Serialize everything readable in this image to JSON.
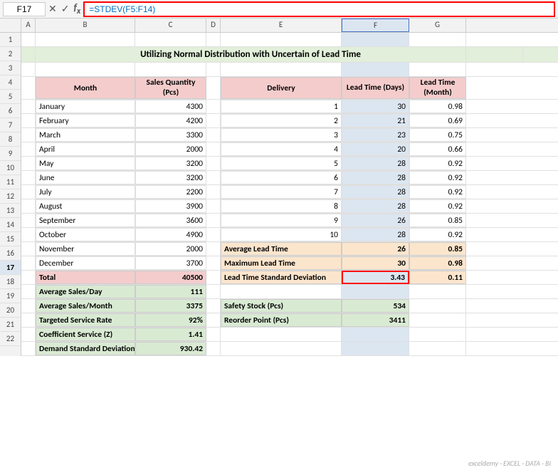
{
  "formula_bar": {
    "cell_ref": "F17",
    "formula": "=STDEV(F5:F14)",
    "icons": [
      "cancel",
      "confirm",
      "function"
    ]
  },
  "col_headers": [
    "",
    "A",
    "B",
    "C",
    "D",
    "E",
    "F",
    "G"
  ],
  "title": "Utilizing Normal Distribution with Uncertain of Lead Time",
  "months": [
    {
      "month": "January",
      "qty": "4300"
    },
    {
      "month": "February",
      "qty": "4200"
    },
    {
      "month": "March",
      "qty": "3300"
    },
    {
      "month": "April",
      "qty": "2000"
    },
    {
      "month": "May",
      "qty": "3200"
    },
    {
      "month": "June",
      "qty": "3200"
    },
    {
      "month": "July",
      "qty": "2200"
    },
    {
      "month": "August",
      "qty": "3900"
    },
    {
      "month": "September",
      "qty": "3600"
    },
    {
      "month": "October",
      "qty": "4900"
    },
    {
      "month": "November",
      "qty": "2000"
    },
    {
      "month": "December",
      "qty": "3700"
    }
  ],
  "delivery": [
    {
      "num": "1",
      "days": "30",
      "month": "0.98"
    },
    {
      "num": "2",
      "days": "21",
      "month": "0.69"
    },
    {
      "num": "3",
      "days": "23",
      "month": "0.75"
    },
    {
      "num": "4",
      "days": "20",
      "month": "0.66"
    },
    {
      "num": "5",
      "days": "28",
      "month": "0.92"
    },
    {
      "num": "6",
      "days": "28",
      "month": "0.92"
    },
    {
      "num": "7",
      "days": "28",
      "month": "0.92"
    },
    {
      "num": "8",
      "days": "28",
      "month": "0.92"
    },
    {
      "num": "9",
      "days": "26",
      "month": "0.85"
    },
    {
      "num": "10",
      "days": "28",
      "month": "0.92"
    }
  ],
  "summary_left": [
    {
      "label": "Total",
      "value": "40500"
    },
    {
      "label": "Average Sales/Day",
      "value": "111"
    },
    {
      "label": "Average Sales/Month",
      "value": "3375"
    },
    {
      "label": "Targeted Service Rate",
      "value": "92%"
    },
    {
      "label": "Coefficient Service (Z)",
      "value": "1.41"
    },
    {
      "label": "Demand Standard Deviation",
      "value": "930.42"
    }
  ],
  "summary_right": [
    {
      "label": "Average Lead Time",
      "days": "26",
      "month": "0.85"
    },
    {
      "label": "Maximum Lead Time",
      "days": "30",
      "month": "0.98"
    },
    {
      "label": "Lead Time Standard Deviation",
      "days": "3.43",
      "month": "0.11"
    }
  ],
  "stock": [
    {
      "label": "Safety Stock (Pcs)",
      "value": "534"
    },
    {
      "label": "Reorder Point (Pcs)",
      "value": "3411"
    }
  ],
  "headers": {
    "month": "Month",
    "sales_qty": "Sales Quantity (Pcs)",
    "delivery": "Delivery",
    "lead_days": "Lead Time (Days)",
    "lead_month": "Lead Time (Month)"
  },
  "colors": {
    "salmon": "#f4cccc",
    "light_orange": "#fce5cd",
    "green": "#d9ead3",
    "title_green": "#e2efda",
    "blue_highlight": "#dce6f1",
    "formula_red": "#ff0000"
  }
}
